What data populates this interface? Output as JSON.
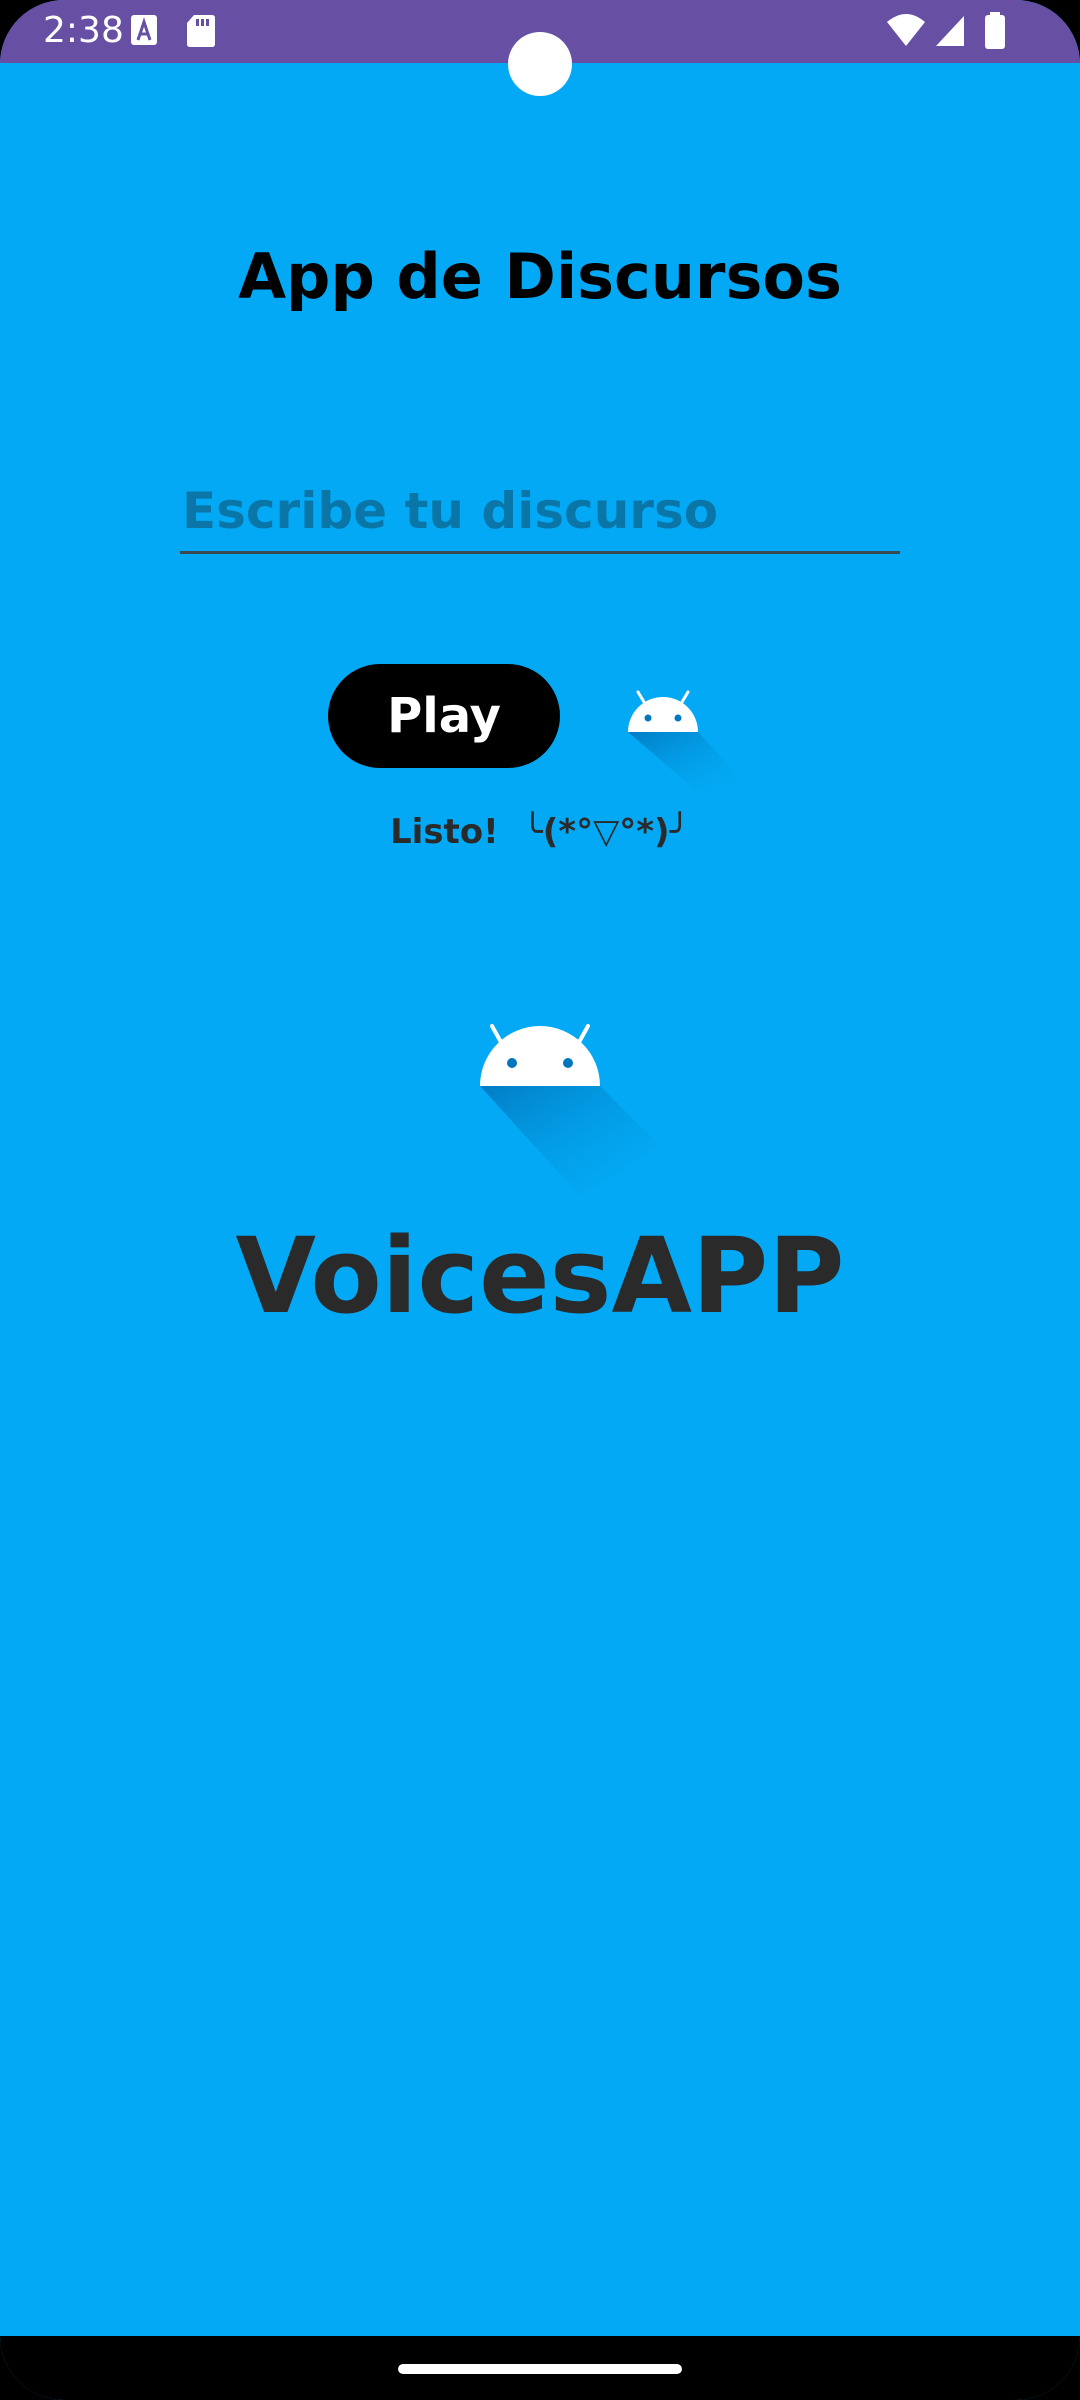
{
  "status_bar": {
    "time": "2:38",
    "color": "#6750A4",
    "left_icons": [
      "font-a-icon",
      "sd-card-icon"
    ],
    "right_icons": [
      "wifi-icon",
      "cellular-signal-icon",
      "battery-icon"
    ]
  },
  "theme": {
    "background": "#03A9F4",
    "button": "#000000",
    "placeholder": "#0A76A8"
  },
  "app": {
    "title": "App de Discursos",
    "input_placeholder": "Escribe tu discurso",
    "input_value": "",
    "play_label": "Play",
    "status": "Listo!  ╰(*°▽°*)╯",
    "brand_name": "VoicesAPP"
  }
}
